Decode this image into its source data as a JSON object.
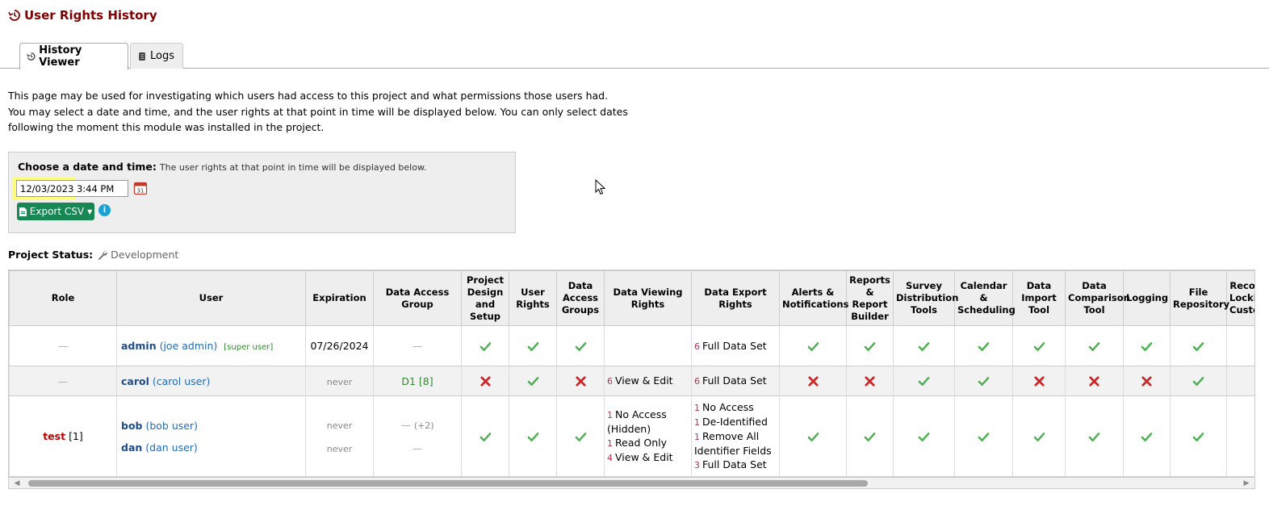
{
  "page": {
    "title": "User Rights History"
  },
  "tabs": [
    {
      "label": "History Viewer",
      "active": true,
      "icon": "history-icon"
    },
    {
      "label": "Logs",
      "active": false,
      "icon": "book-icon"
    }
  ],
  "intro": {
    "line1": "This page may be used for investigating which users had access to this project and what permissions those users had.",
    "line2": "You may select a date and time, and the user rights at that point in time will be displayed below. You can only select dates",
    "line3": "following the moment this module was installed in the project."
  },
  "picker": {
    "label": "Choose a date and time:",
    "hint": "The user rights at that point in time will be displayed below.",
    "value": "12/03/2023 3:44 PM",
    "export_label": "Export CSV",
    "info_glyph": "i"
  },
  "project_status": {
    "label": "Project Status:",
    "value": "Development"
  },
  "table": {
    "headers": [
      "Role",
      "User",
      "Expiration",
      "Data Access Group",
      "Project Design and Setup",
      "User Rights",
      "Data Access Groups",
      "Data Viewing Rights",
      "Data Export Rights",
      "Alerts & Notifications",
      "Reports & Report Builder",
      "Survey Distribution Tools",
      "Calendar & Scheduling",
      "Data Import Tool",
      "Data Comparison Tool",
      "Logging",
      "File Repository",
      "Record Locking Customization"
    ],
    "rows": [
      {
        "role": "—",
        "users": [
          {
            "name": "admin",
            "full": "(joe admin)",
            "tag": "[super user]",
            "expiration": "07/26/2024"
          }
        ],
        "dag": "—",
        "design": "check",
        "user_rights": "check",
        "dags": "check",
        "viewing": [],
        "export": [
          {
            "count": "6",
            "label": "Full Data Set"
          }
        ],
        "perms": [
          "check",
          "check",
          "check",
          "check",
          "check",
          "check",
          "check",
          "check"
        ]
      },
      {
        "role": "—",
        "users": [
          {
            "name": "carol",
            "full": "(carol user)",
            "tag": "",
            "expiration": "never"
          }
        ],
        "dag": "D1 [8]",
        "design": "cross",
        "user_rights": "check",
        "dags": "cross",
        "viewing": [
          {
            "count": "6",
            "label": "View & Edit"
          }
        ],
        "export": [
          {
            "count": "6",
            "label": "Full Data Set"
          }
        ],
        "perms": [
          "cross",
          "cross",
          "check",
          "check",
          "cross",
          "cross",
          "cross",
          "check"
        ]
      },
      {
        "role": "test",
        "role_count": "[1]",
        "users": [
          {
            "name": "bob",
            "full": "(bob user)",
            "tag": "",
            "expiration": "never"
          },
          {
            "name": "dan",
            "full": "(dan user)",
            "tag": "",
            "expiration": "never"
          }
        ],
        "dag": "—",
        "dag_extra": "(+2)",
        "dag2": "—",
        "design": "check",
        "user_rights": "check",
        "dags": "check",
        "viewing": [
          {
            "count": "1",
            "label": "No Access"
          },
          {
            "count": "",
            "label": "(Hidden)"
          },
          {
            "count": "1",
            "label": "Read Only"
          },
          {
            "count": "4",
            "label": "View & Edit"
          }
        ],
        "export": [
          {
            "count": "1",
            "label": "No Access"
          },
          {
            "count": "1",
            "label": "De-Identified"
          },
          {
            "count": "1",
            "label": "Remove All"
          },
          {
            "count": "",
            "label": "Identifier Fields"
          },
          {
            "count": "3",
            "label": "Full Data Set"
          }
        ],
        "perms": [
          "check",
          "check",
          "check",
          "check",
          "check",
          "check",
          "check",
          "check"
        ]
      }
    ]
  },
  "colors": {
    "title": "#800000",
    "check": "#4caf50",
    "cross": "#c62828",
    "export_btn": "#198754"
  }
}
